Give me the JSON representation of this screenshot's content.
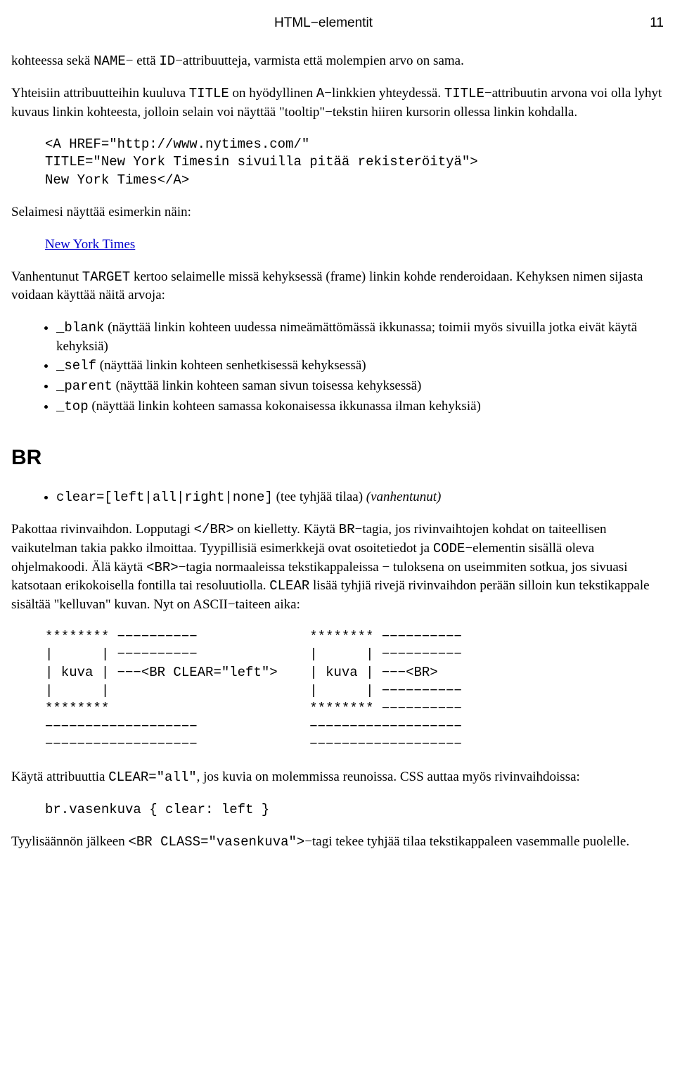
{
  "header": {
    "title": "HTML−elementit",
    "page": "11"
  },
  "p1": {
    "a": "kohteessa sekä ",
    "b": "NAME",
    "c": "− että ",
    "d": "ID",
    "e": "−attribuutteja, varmista että molempien arvo on sama."
  },
  "p2": {
    "a": "Yhteisiin attribuutteihin kuuluva ",
    "b": "TITLE",
    "c": " on hyödyllinen ",
    "d": "A",
    "e": "−linkkien yhteydessä. ",
    "f": "TITLE",
    "g": "−attribuutin arvona voi olla lyhyt kuvaus linkin kohteesta, jolloin selain voi näyttää \"tooltip\"−tekstin hiiren kursorin ollessa linkin kohdalla."
  },
  "code1": "<A HREF=\"http://www.nytimes.com/\"\nTITLE=\"New York Timesin sivuilla pitää rekisteröityä\">\nNew York Times</A>",
  "p3": "Selaimesi näyttää esimerkin näin:",
  "link1": "New York Times",
  "p4": {
    "a": "Vanhentunut ",
    "b": "TARGET",
    "c": " kertoo selaimelle missä kehyksessä (frame) linkin kohde renderoidaan. Kehyksen nimen sijasta voidaan käyttää näitä arvoja:"
  },
  "ul1": {
    "i0": {
      "a": "_blank",
      "b": " (näyttää linkin kohteen uudessa nimeämättömässä ikkunassa; toimii myös sivuilla jotka eivät käytä kehyksiä)"
    },
    "i1": {
      "a": "_self",
      "b": " (näyttää linkin kohteen senhetkisessä kehyksessä)"
    },
    "i2": {
      "a": "_parent",
      "b": " (näyttää linkin kohteen saman sivun toisessa kehyksessä)"
    },
    "i3": {
      "a": "_top",
      "b": " (näyttää linkin kohteen samassa kokonaisessa ikkunassa ilman kehyksiä)"
    }
  },
  "h2": "BR",
  "ul2": {
    "i0": {
      "a": "clear=[left|all|right|none]",
      "b": " (tee tyhjää tilaa) ",
      "c": "(vanhentunut)"
    }
  },
  "p5": {
    "a": "Pakottaa rivinvaihdon. Lopputagi ",
    "b": "</BR>",
    "c": " on kielletty. Käytä ",
    "d": "BR",
    "e": "−tagia, jos rivinvaihtojen kohdat on taiteellisen vaikutelman takia pakko ilmoittaa. Tyypillisiä esimerkkejä ovat osoitetiedot ja ",
    "f": "CODE",
    "g": "−elementin sisällä oleva ohjelmakoodi. Älä käytä ",
    "h": "<BR>",
    "i": "−tagia normaaleissa tekstikappaleissa − tuloksena on useimmiten sotkua, jos sivuasi katsotaan erikokoisella fontilla tai resoluutiolla. ",
    "j": "CLEAR",
    "k": " lisää tyhjiä rivejä rivinvaihdon perään silloin kun tekstikappale sisältää \"kelluvan\" kuvan. Nyt on ASCII−taiteen aika:"
  },
  "ascii": "******** −−−−−−−−−−              ******** −−−−−−−−−−\n|      | −−−−−−−−−−              |      | −−−−−−−−−−\n| kuva | −−−<BR CLEAR=\"left\">    | kuva | −−−<BR>\n|      |                         |      | −−−−−−−−−−\n********                         ******** −−−−−−−−−−\n−−−−−−−−−−−−−−−−−−−              −−−−−−−−−−−−−−−−−−−\n−−−−−−−−−−−−−−−−−−−              −−−−−−−−−−−−−−−−−−−",
  "p6": {
    "a": "Käytä attribuuttia ",
    "b": "CLEAR=\"all\"",
    "c": ", jos kuvia on molemmissa reunoissa. CSS auttaa myös rivinvaihdoissa:"
  },
  "code2": "br.vasenkuva { clear: left }",
  "p7": {
    "a": "Tyylisäännön jälkeen ",
    "b": "<BR CLASS=\"vasenkuva\">",
    "c": "−tagi tekee tyhjää tilaa tekstikappaleen vasemmalle puolelle."
  }
}
